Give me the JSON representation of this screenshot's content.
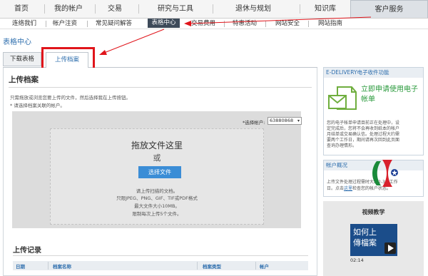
{
  "top_nav": {
    "items": [
      "首页",
      "我的帐户",
      "交易",
      "研究与工具",
      "退休与规划",
      "知识库"
    ],
    "active": "客户服务"
  },
  "sub_nav": {
    "items": [
      "连络我们",
      "帐户注资",
      "常见疑问解答",
      "表格中心",
      "交易费用",
      "特惠活动",
      "网站安全",
      "网站指南"
    ],
    "active_index": 3
  },
  "page_title": "表格中心",
  "tabs": [
    "下载表格",
    "上传档案"
  ],
  "upload": {
    "heading": "上传档案",
    "instruction_1": "只需拖放或浏览您要上传的文件，然后选择我在上传按钮。",
    "instruction_2": "* 请选择档案关联的帐户。",
    "account_label": "*选择帐户:",
    "account_value": "63880868",
    "drop_title": "拖放文件这里",
    "drop_or": "或",
    "choose_button": "选择文件",
    "req_1": "请上传扫描的文档。",
    "req_2": "只限JPEG、PNG、GIF、TIF或PDF格式",
    "req_3": "最大文件大小10MB。",
    "req_4": "限制每次上传5个文件。"
  },
  "records": {
    "heading": "上传记录",
    "columns": [
      "日期",
      "档案名称",
      "档案类型",
      "帐户"
    ]
  },
  "edelivery": {
    "heading": "E-DELIVERY电子收件功能",
    "cta": "立即申请使用电子帐单",
    "text_1": "您的电子帐单申请目前正在处理中，设",
    "text_2": "定完成后，您将不会再收到纸本的帐户",
    "text_3": "月结单或交易确认信。处理过程大约需",
    "text_4": "要两个工作日，期间请再次回到此页面",
    "text_5": "查询办理情形。"
  },
  "account_overview": {
    "heading": "帐户概况",
    "text_1": "上传文件处理过程需时大约2-3个工作",
    "text_2a": "日。点击",
    "text_2_link": "这里",
    "text_2b": "检查您的帐户状态。"
  },
  "video": {
    "heading": "视频教学",
    "thumb_text_1": "如何上",
    "thumb_text_2": "傳檔案",
    "duration": "02:14"
  }
}
